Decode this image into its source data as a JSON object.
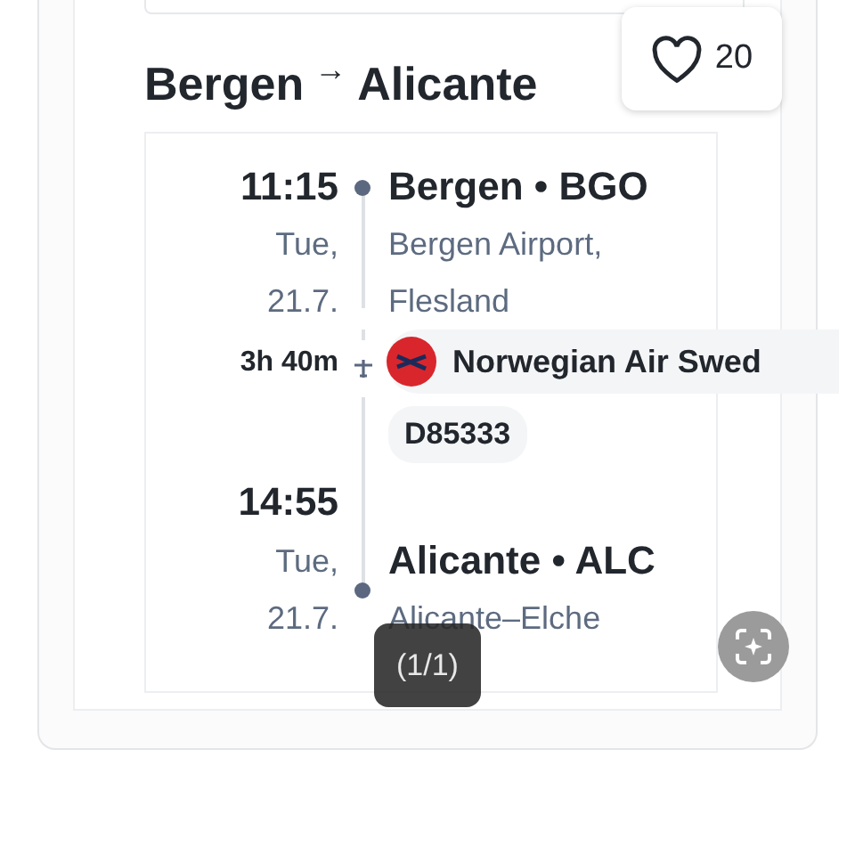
{
  "route": {
    "from": "Bergen",
    "arrow": "→",
    "to": "Alicante"
  },
  "like": {
    "count": "20"
  },
  "departure": {
    "time": "11:15",
    "day": "Tue,",
    "date": "21.7.",
    "place": "Bergen • BGO",
    "airport": [
      "Bergen Airport,",
      "Flesland"
    ]
  },
  "duration": "3h 40m",
  "airline": "Norwegian Air Swed",
  "flight_number": "D85333",
  "arrival": {
    "time": "14:55",
    "day": "Tue,",
    "date": "21.7.",
    "place": "Alicante • ALC",
    "airport": [
      "Alicante–Elche"
    ]
  },
  "image_counter": "(1/1)"
}
